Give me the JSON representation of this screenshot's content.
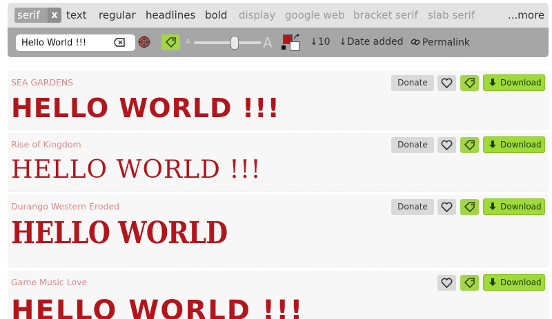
{
  "tags": {
    "active": "serif",
    "remove": "x",
    "items": [
      "text",
      "regular",
      "headlines",
      "bold",
      "display",
      "google web",
      "bracket serif",
      "slab serif"
    ],
    "more": "...more"
  },
  "toolbar": {
    "search_value": "Hello World !!!",
    "size_small": "A",
    "size_large": "A",
    "size_level": 0.6,
    "sort_count": "↓10",
    "sort_date": "↓Date added",
    "permalink": "Permalink",
    "text_color": "#b2161d",
    "bg_color": "#ffffff"
  },
  "colors": {
    "accent_green": "#9fd93a",
    "preview_red": "#b2161d",
    "name_pink": "#d98a8a"
  },
  "buttons": {
    "donate": "Donate",
    "download": "Download"
  },
  "fonts": [
    {
      "name": "SEA GARDENS",
      "preview": "HELLO WORLD !!!",
      "has_donate": true
    },
    {
      "name": "Rise of Kingdom",
      "preview": "HELLO WORLD !!!",
      "has_donate": true
    },
    {
      "name": "Durango Western Eroded",
      "preview": "HELLO WORLD",
      "has_donate": true
    },
    {
      "name": "Game Music Love",
      "preview": "HELLO WORLD !!!",
      "has_donate": false
    }
  ]
}
